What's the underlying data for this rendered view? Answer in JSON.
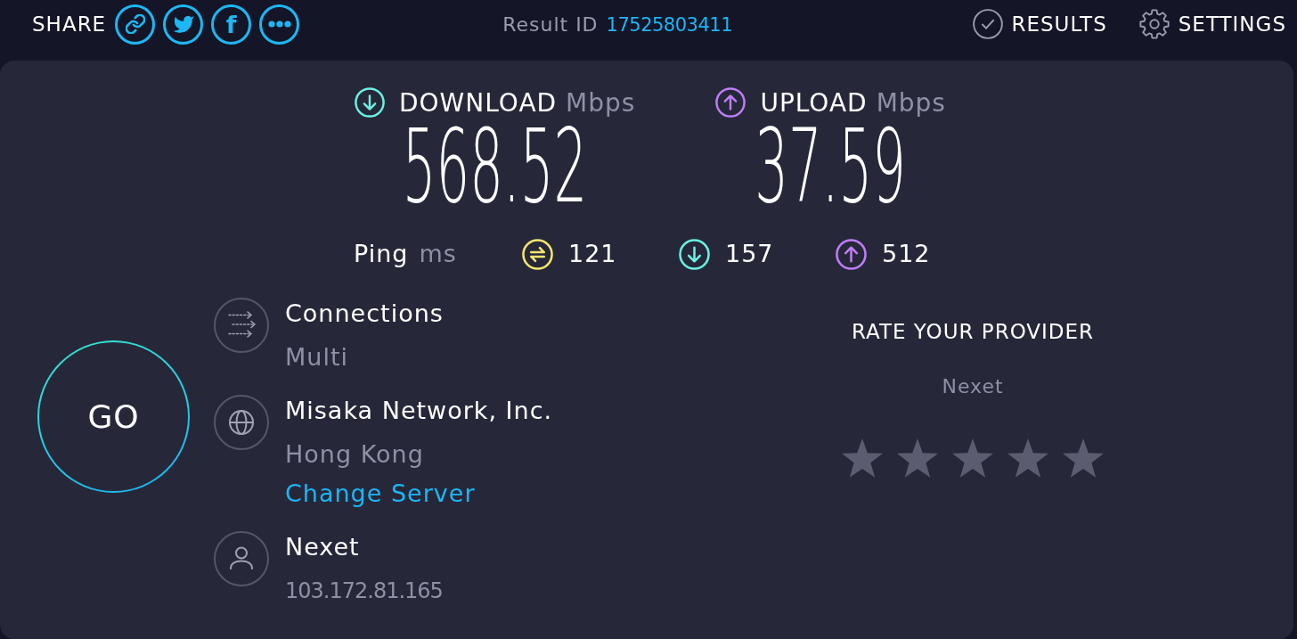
{
  "topbar": {
    "share": {
      "label": "SHARE",
      "buttons": [
        {
          "kind": "link"
        },
        {
          "kind": "bird"
        },
        {
          "kind": "text",
          "label": "f"
        },
        {
          "kind": "dots"
        }
      ]
    },
    "result": {
      "label": "Result ID",
      "id": "17525803411"
    },
    "nav": [
      {
        "kind": "check",
        "label": "RESULTS"
      },
      {
        "kind": "gear",
        "label": "SETTINGS"
      }
    ]
  },
  "speeds": [
    {
      "kind": "down",
      "color": "#6af2e3",
      "label": "DOWNLOAD",
      "unit": "Mbps",
      "value": "568.52"
    },
    {
      "kind": "up",
      "color": "#bf7df8",
      "label": "UPLOAD",
      "unit": "Mbps",
      "value": "37.59"
    }
  ],
  "ping": {
    "label": "Ping",
    "unit": "ms",
    "items": [
      {
        "kind": "swap",
        "color": "#f5e66e",
        "value": "121"
      },
      {
        "kind": "down",
        "color": "#6af2e3",
        "value": "157"
      },
      {
        "kind": "up",
        "color": "#bf7df8",
        "value": "512"
      }
    ]
  },
  "go_button": {
    "label": "GO"
  },
  "info": [
    {
      "kind": "arrows",
      "title": "Connections",
      "value": "Multi"
    },
    {
      "kind": "globe",
      "title": "Misaka Network, Inc.",
      "value": "Hong Kong",
      "link": "Change Server"
    },
    {
      "kind": "person",
      "title": "Nexet",
      "value": "103.172.81.165"
    }
  ],
  "rating": {
    "title": "RATE YOUR PROVIDER",
    "provider": "Nexet",
    "stars": 0
  }
}
